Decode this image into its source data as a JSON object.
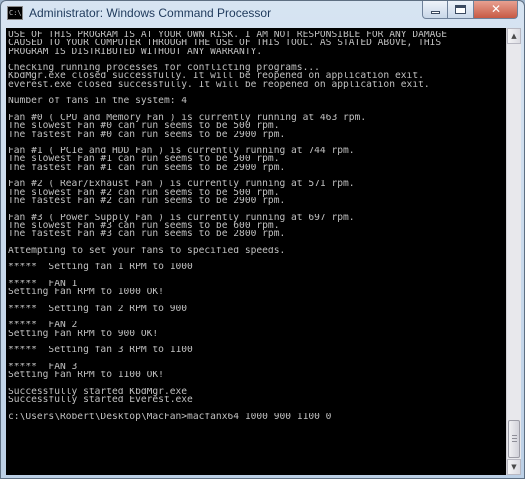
{
  "window": {
    "title": "Administrator: Windows Command Processor",
    "icon_label": "C:\\",
    "icons": {
      "app": "command-prompt-icon",
      "minimize": "minimize-icon",
      "maximize": "maximize-icon",
      "close": "close-icon"
    },
    "close_glyph": "✕"
  },
  "console": {
    "lines": [
      "USE OF THIS PROGRAM IS AT YOUR OWN RISK. I AM NOT RESPONSIBLE FOR ANY DAMAGE",
      "CAUSED TO YOUR COMPUTER THROUGH THE USE OF THIS TOOL. AS STATED ABOVE, THIS",
      "PROGRAM IS DISTRIBUTED WITHOUT ANY WARRANTY.",
      "",
      "Checking running processes for conflicting programs...",
      "KbdMgr.exe closed successfully. It will be reopened on application exit.",
      "everest.exe closed successfully. It will be reopened on application exit.",
      "",
      "Number of fans in the system: 4",
      "",
      "Fan #0 ( CPU and Memory Fan ) is currently running at 463 rpm.",
      "The slowest Fan #0 can run seems to be 500 rpm.",
      "The fastest Fan #0 can run seems to be 2900 rpm.",
      "",
      "Fan #1 ( PCIe and HDD Fan ) is currently running at 744 rpm.",
      "The slowest Fan #1 can run seems to be 500 rpm.",
      "The fastest Fan #1 can run seems to be 2900 rpm.",
      "",
      "Fan #2 ( Rear/Exhaust Fan ) is currently running at 571 rpm.",
      "The slowest Fan #2 can run seems to be 500 rpm.",
      "The fastest Fan #2 can run seems to be 2900 rpm.",
      "",
      "Fan #3 ( Power Supply Fan ) is currently running at 697 rpm.",
      "The slowest Fan #3 can run seems to be 600 rpm.",
      "The fastest Fan #3 can run seems to be 2800 rpm.",
      "",
      "Attempting to set your fans to specified speeds.",
      "",
      "*****  Setting fan 1 RPM to 1000",
      "",
      "*****  FAN 1",
      "Setting Fan RPM to 1000 OK!",
      "",
      "*****  Setting fan 2 RPM to 900",
      "",
      "*****  FAN 2",
      "Setting Fan RPM to 900 OK!",
      "",
      "*****  Setting fan 3 RPM to 1100",
      "",
      "*****  FAN 3",
      "Setting Fan RPM to 1100 OK!",
      "",
      "Successfully started KbdMgr.exe",
      "Successfully started Everest.exe",
      "",
      "c:\\Users\\Robert\\Desktop\\MacFan>macfanx64 1000 900 1100 0"
    ]
  },
  "scrollbar": {
    "up_arrow": "▲",
    "down_arrow": "▼"
  }
}
